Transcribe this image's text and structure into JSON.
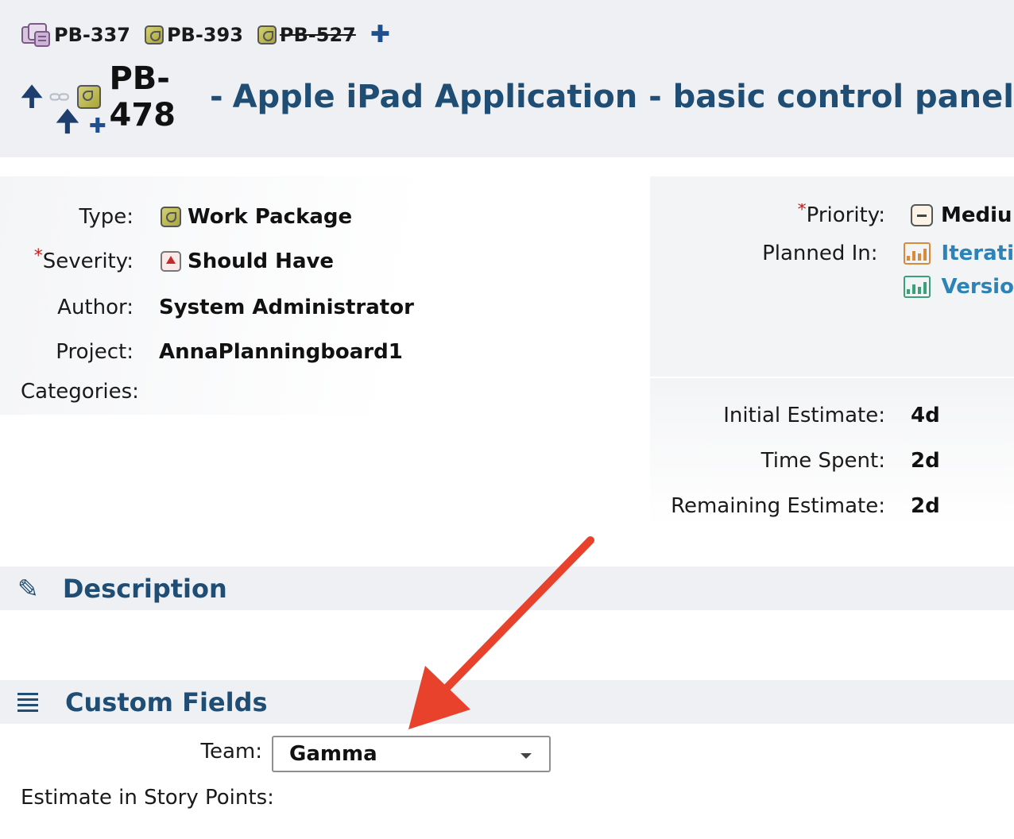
{
  "header": {
    "parents": [
      {
        "key": "PB-337",
        "icon": "epic-icon",
        "struck": false
      },
      {
        "key": "PB-393",
        "icon": "work-package-icon",
        "struck": false
      },
      {
        "key": "PB-527",
        "icon": "work-package-icon",
        "struck": true
      }
    ],
    "add_parent_icon": "plus-icon",
    "issue_key": "PB-478",
    "separator": "-",
    "title": "Apple iPad Application - basic control panel"
  },
  "details": {
    "type_label": "Type:",
    "type_value": "Work Package",
    "severity_label": "Severity:",
    "severity_value": "Should Have",
    "author_label": "Author:",
    "author_value": "System Administrator",
    "project_label": "Project:",
    "project_value": "AnnaPlanningboard1",
    "categories_label": "Categories:",
    "required_marker": "*"
  },
  "planning": {
    "priority_label": "Priority:",
    "priority_value": "Mediu",
    "planned_in_label": "Planned In:",
    "planned_in": [
      "Iterati",
      "Versio"
    ]
  },
  "estimates": {
    "initial_label": "Initial Estimate:",
    "initial_value": "4d",
    "spent_label": "Time Spent:",
    "spent_value": "2d",
    "remaining_label": "Remaining Estimate:",
    "remaining_value": "2d"
  },
  "sections": {
    "description_title": "Description",
    "custom_fields_title": "Custom Fields"
  },
  "custom_fields": {
    "team_label": "Team:",
    "team_value": "Gamma",
    "story_points_label": "Estimate in Story Points:"
  },
  "colors": {
    "header_bg": "#eef0f4",
    "title_blue": "#1f4d74",
    "link_blue": "#2b83b8",
    "annotation_arrow": "#e8412c",
    "required_red": "#c0201d"
  }
}
